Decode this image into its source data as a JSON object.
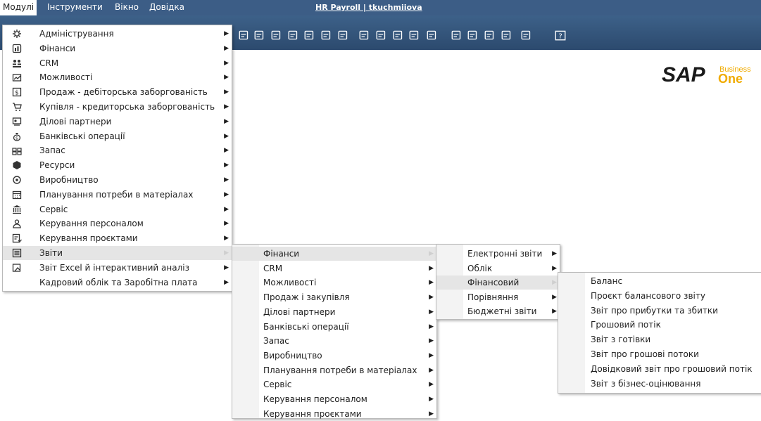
{
  "menubar": {
    "items": [
      "Модулі",
      "Інструменти",
      "Вікно",
      "Довідка"
    ],
    "title": "HR Payroll | tkuchmiiova"
  },
  "toolbar": {
    "icons": [
      "copy-icon",
      "report-icon",
      "edit-icon",
      "document-icon",
      "export-icon",
      "message-icon",
      "chat-icon",
      "payment-icon",
      "payment2-icon",
      "calculator-icon",
      "org-icon",
      "person-icon",
      "doc2-icon",
      "layout-icon",
      "chart-icon",
      "pen-icon",
      "web-icon",
      "help-icon"
    ]
  },
  "logo": {
    "brand": "SAP",
    "business": "Business",
    "one": "One",
    "color_sap": "#1a1a1a",
    "color_one": "#f0ab00"
  },
  "menus": {
    "modules": [
      {
        "label": "Адміністрування",
        "icon": "admin-gear-icon",
        "submenu": true
      },
      {
        "label": "Фінанси",
        "icon": "finance-icon",
        "submenu": true
      },
      {
        "label": "CRM",
        "icon": "crm-people-icon",
        "submenu": true
      },
      {
        "label": "Можливості",
        "icon": "opportunities-icon",
        "submenu": true
      },
      {
        "label": "Продаж - дебіторська заборгованість",
        "icon": "dollar-icon",
        "submenu": true
      },
      {
        "label": "Купівля - кредиторська заборгованість",
        "icon": "cart-icon",
        "submenu": true
      },
      {
        "label": "Ділові партнери",
        "icon": "partners-icon",
        "submenu": true
      },
      {
        "label": "Банківські операції",
        "icon": "money-bag-icon",
        "submenu": true
      },
      {
        "label": "Запас",
        "icon": "inventory-icon",
        "submenu": true
      },
      {
        "label": "Ресурси",
        "icon": "resources-icon",
        "submenu": true
      },
      {
        "label": "Виробництво",
        "icon": "production-icon",
        "submenu": true
      },
      {
        "label": "Планування потреби в матеріалах",
        "icon": "calendar-icon",
        "submenu": true
      },
      {
        "label": "Сервіс",
        "icon": "service-icon",
        "submenu": true
      },
      {
        "label": "Керування персоналом",
        "icon": "person-icon",
        "submenu": true
      },
      {
        "label": "Керування проєктами",
        "icon": "project-icon",
        "submenu": true
      },
      {
        "label": "Звіти",
        "icon": "reports-icon",
        "submenu": true,
        "highlighted": true
      },
      {
        "label": "Звіт Excel й інтерактивний аналіз",
        "icon": "excel-report-icon",
        "submenu": true
      },
      {
        "label": "Кадровий облік та Заробітна плата",
        "icon": "",
        "submenu": true
      }
    ],
    "reports": [
      {
        "label": "Фінанси",
        "submenu": true,
        "highlighted": true
      },
      {
        "label": "CRM",
        "submenu": true
      },
      {
        "label": "Можливості",
        "submenu": true
      },
      {
        "label": "Продаж і закупівля",
        "submenu": true
      },
      {
        "label": "Ділові партнери",
        "submenu": true
      },
      {
        "label": "Банківські операції",
        "submenu": true
      },
      {
        "label": "Запас",
        "submenu": true
      },
      {
        "label": "Виробництво",
        "submenu": true
      },
      {
        "label": "Планування потреби в матеріалах",
        "submenu": true
      },
      {
        "label": "Сервіс",
        "submenu": true
      },
      {
        "label": "Керування персоналом",
        "submenu": true
      },
      {
        "label": "Керування проєктами",
        "submenu": true
      }
    ],
    "finance": [
      {
        "label": "Електронні звіти",
        "submenu": true
      },
      {
        "label": "Облік",
        "submenu": true
      },
      {
        "label": "Фінансовий",
        "submenu": true,
        "highlighted": true
      },
      {
        "label": "Порівняння",
        "submenu": true
      },
      {
        "label": "Бюджетні звіти",
        "submenu": true
      }
    ],
    "financial": [
      {
        "label": "Баланс"
      },
      {
        "label": "Проєкт балансового звіту"
      },
      {
        "label": "Звіт про прибутки та збитки"
      },
      {
        "label": "Грошовий потік"
      },
      {
        "label": "Звіт з готівки"
      },
      {
        "label": "Звіт про грошові потоки"
      },
      {
        "label": "Довідковий звіт про грошовий потік"
      },
      {
        "label": "Звіт з бізнес-оцінювання"
      }
    ]
  }
}
